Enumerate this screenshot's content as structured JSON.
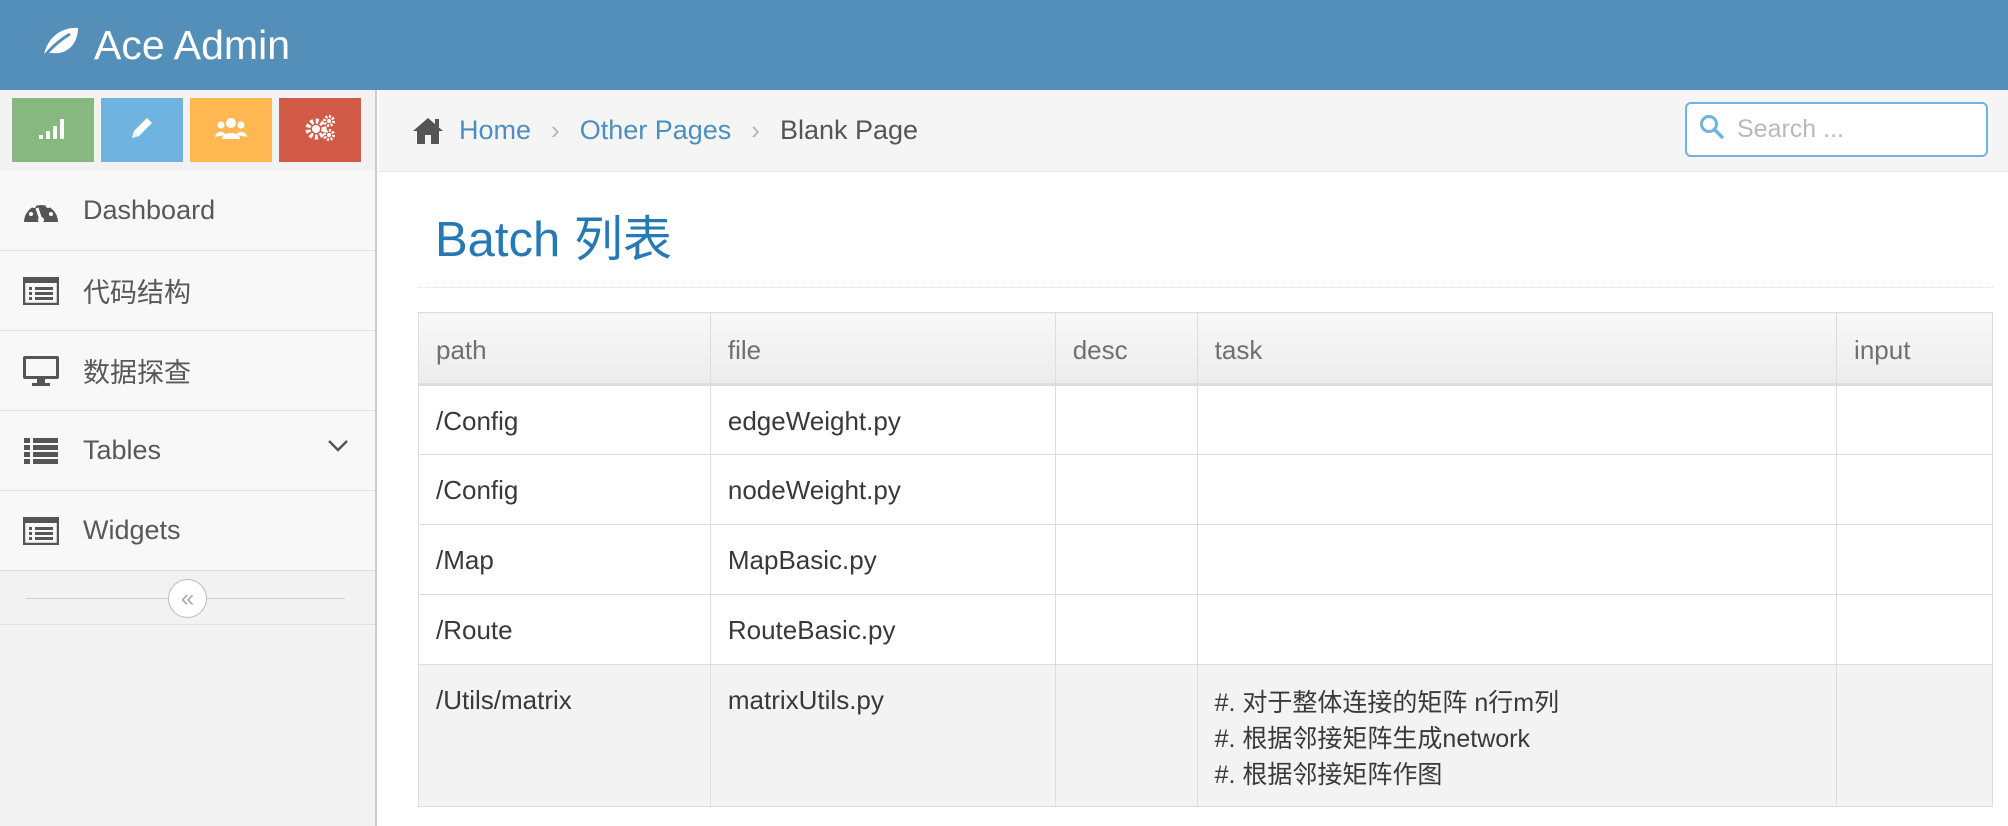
{
  "app": {
    "title": "Ace Admin"
  },
  "shortcuts": [
    {
      "name": "stats-shortcut",
      "color": "#87b87f",
      "icon": "signal-icon"
    },
    {
      "name": "edit-shortcut",
      "color": "#6fb3e0",
      "icon": "pencil-icon"
    },
    {
      "name": "users-shortcut",
      "color": "#ffb752",
      "icon": "users-icon"
    },
    {
      "name": "settings-shortcut",
      "color": "#d15b47",
      "icon": "cogs-icon"
    }
  ],
  "sidebar": {
    "items": [
      {
        "label": "Dashboard",
        "icon": "tachometer-icon"
      },
      {
        "label": "代码结构",
        "icon": "list-alt-icon"
      },
      {
        "label": "数据探查",
        "icon": "desktop-icon"
      },
      {
        "label": "Tables",
        "icon": "list-icon",
        "has_submenu": true
      },
      {
        "label": "Widgets",
        "icon": "list-alt-icon"
      }
    ],
    "collapse_label": "«"
  },
  "breadcrumb": {
    "items": [
      {
        "label": "Home"
      },
      {
        "label": "Other Pages"
      },
      {
        "label": "Blank Page"
      }
    ]
  },
  "search": {
    "placeholder": "Search ..."
  },
  "page": {
    "title": "Batch 列表"
  },
  "table": {
    "columns": [
      "path",
      "file",
      "desc",
      "task",
      "input"
    ],
    "rows": [
      {
        "path": "/Config",
        "file": "edgeWeight.py",
        "desc": "",
        "task": [],
        "input": ""
      },
      {
        "path": "/Config",
        "file": "nodeWeight.py",
        "desc": "",
        "task": [],
        "input": ""
      },
      {
        "path": "/Map",
        "file": "MapBasic.py",
        "desc": "",
        "task": [],
        "input": ""
      },
      {
        "path": "/Route",
        "file": "RouteBasic.py",
        "desc": "",
        "task": [],
        "input": ""
      },
      {
        "path": "/Utils/matrix",
        "file": "matrixUtils.py",
        "desc": "",
        "task": [
          "#. 对于整体连接的矩阵 n行m列",
          "#. 根据邻接矩阵生成network",
          "#. 根据邻接矩阵作图"
        ],
        "input": ""
      }
    ]
  },
  "colors": {
    "navbar": "#548fb9",
    "link": "#4c8fbd",
    "title": "#2679b5"
  }
}
